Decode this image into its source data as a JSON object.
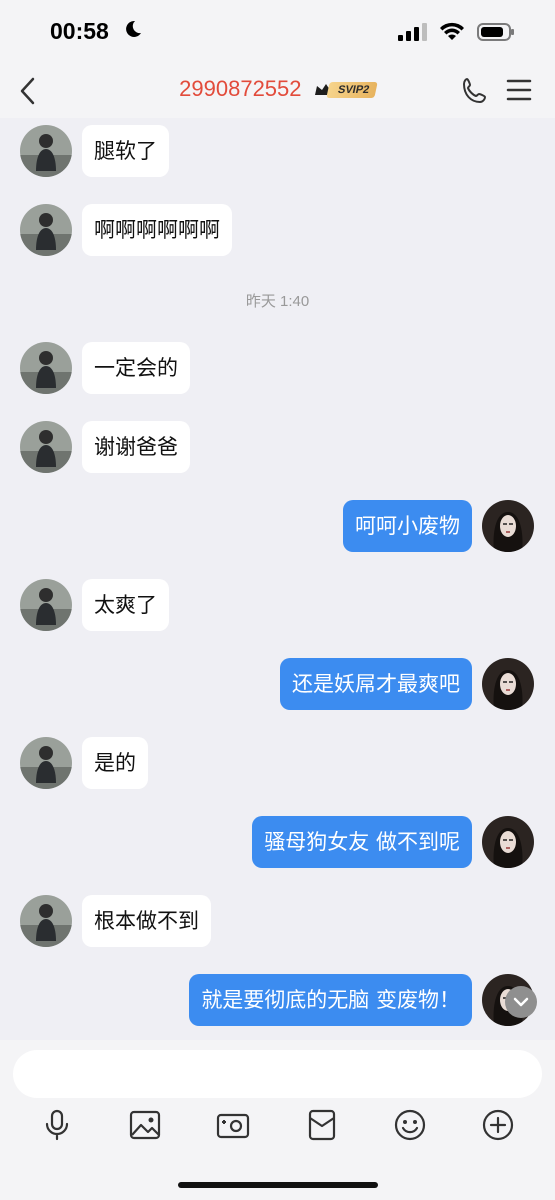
{
  "status": {
    "time": "00:58"
  },
  "header": {
    "title": "2990872552",
    "badge": "SVIP2"
  },
  "timestamp": "昨天 1:40",
  "messages": [
    {
      "side": "left",
      "text": "腿软了"
    },
    {
      "side": "left",
      "text": "啊啊啊啊啊啊"
    },
    {
      "side": "left",
      "text": "一定会的"
    },
    {
      "side": "left",
      "text": "谢谢爸爸"
    },
    {
      "side": "right",
      "text": "呵呵小废物"
    },
    {
      "side": "left",
      "text": "太爽了"
    },
    {
      "side": "right",
      "text": "还是妖屌才最爽吧"
    },
    {
      "side": "left",
      "text": "是的"
    },
    {
      "side": "right",
      "text": "骚母狗女友 做不到呢"
    },
    {
      "side": "left",
      "text": "根本做不到"
    },
    {
      "side": "right",
      "text": "就是要彻底的无脑 变废物！"
    }
  ],
  "toolbar": [
    "microphone-icon",
    "image-icon",
    "camera-icon",
    "red-packet-icon",
    "emoji-icon",
    "plus-icon"
  ],
  "colors": {
    "title": "#e24b3b",
    "bubble_right": "#3c8cf0",
    "bubble_left": "#ffffff"
  }
}
